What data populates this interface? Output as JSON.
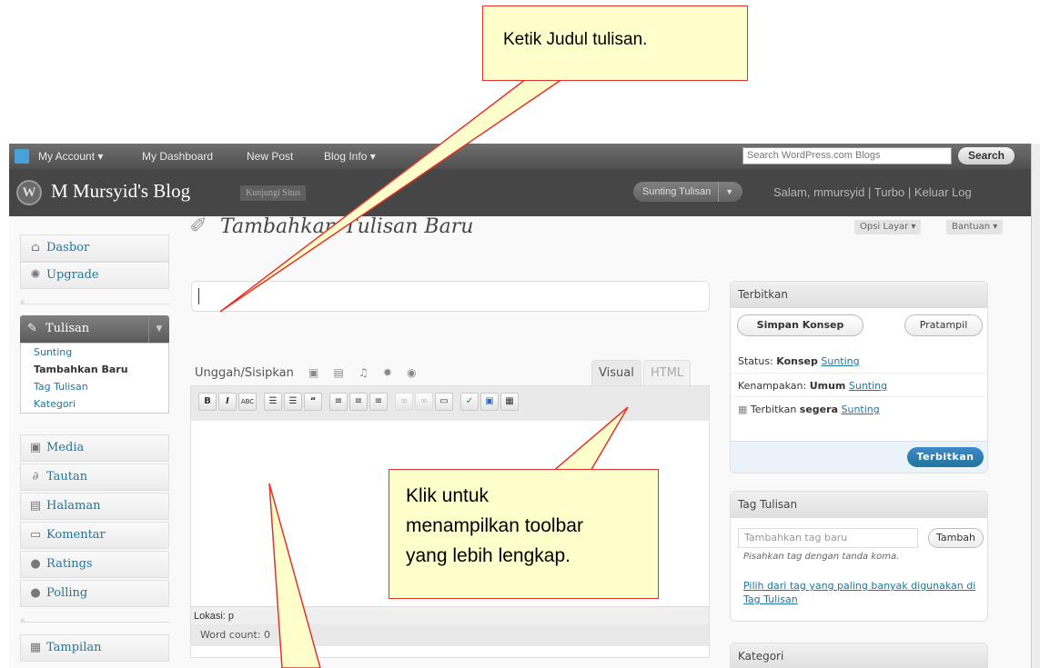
{
  "adminbar": {
    "account": "My Account ▾",
    "dashboard": "My Dashboard",
    "new_post": "New Post",
    "blog_info": "Blog Info ▾",
    "search_placeholder": "Search WordPress.com Blogs",
    "search_button": "Search"
  },
  "header": {
    "blog_name": "M Mursyid's Blog",
    "visit_site": "Kunjungi Situs",
    "edit_button": "Sunting Tulisan",
    "greeting": "Salam, mmursyid | Turbo | Keluar Log"
  },
  "screen_options": {
    "options": "Opsi Layar ▾",
    "help": "Bantuan ▾"
  },
  "menu": {
    "dashboard": "Dasbor",
    "upgrade": "Upgrade",
    "posts": "Tulisan",
    "posts_sub": [
      "Sunting",
      "Tambahkan Baru",
      "Tag Tulisan",
      "Kategori"
    ],
    "media": "Media",
    "links": "Tautan",
    "pages": "Halaman",
    "comments": "Komentar",
    "ratings": "Ratings",
    "polls": "Polling",
    "appearance": "Tampilan"
  },
  "main": {
    "page_title": "Tambahkan Tulisan Baru",
    "upload_label": "Unggah/Sisipkan",
    "tab_visual": "Visual",
    "tab_html": "HTML",
    "toolbar": {
      "bold": "B",
      "italic": "I",
      "strike": "ABC",
      "bullets": "☰",
      "numbers": "☰",
      "quote": "“",
      "align_left": "≡",
      "align_center": "≡",
      "align_right": "≡",
      "link": "∞",
      "unlink": "∞",
      "more": "▭",
      "spell": "✓",
      "fullscreen": "▣",
      "kitchen_sink": "▦"
    },
    "location": "Lokasi: p",
    "word_count": "Word count: 0"
  },
  "publish": {
    "title": "Terbitkan",
    "save_draft": "Simpan Konsep",
    "preview": "Pratampil",
    "status_label": "Status: ",
    "status_value": "Konsep",
    "visibility_label": "Kenampakan: ",
    "visibility_value": "Umum",
    "publish_label": "Terbitkan ",
    "publish_value": "segera",
    "edit_link": "Sunting",
    "publish_button": "Terbitkan"
  },
  "tags": {
    "title": "Tag Tulisan",
    "placeholder": "Tambahkan tag baru",
    "add_button": "Tambah",
    "hint": "Pisahkan tag dengan tanda koma.",
    "popular_link": "Pilih dari tag yang paling banyak digunakan di Tag Tulisan"
  },
  "categories": {
    "title": "Kategori"
  },
  "callouts": {
    "title_hint": "Ketik Judul tulisan.",
    "toolbar_hint_1": "Klik untuk",
    "toolbar_hint_2": "menampilkan toolbar",
    "toolbar_hint_3": "yang lebih lengkap."
  }
}
